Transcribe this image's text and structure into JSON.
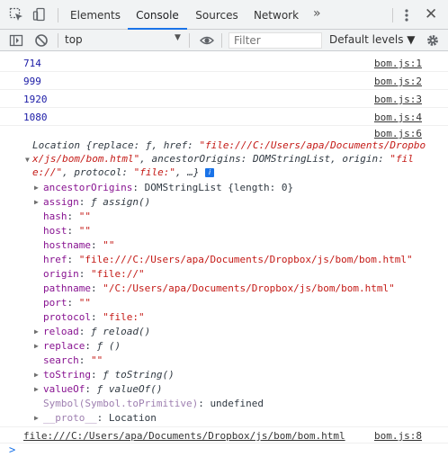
{
  "tabs": {
    "elements": "Elements",
    "console": "Console",
    "sources": "Sources",
    "network": "Network",
    "more": "»"
  },
  "toolbar": {
    "context": "top",
    "filter_placeholder": "Filter",
    "levels": "Default levels ▼"
  },
  "logs": {
    "l1": {
      "value": "714",
      "source": "bom.js:1"
    },
    "l2": {
      "value": "999",
      "source": "bom.js:2"
    },
    "l3": {
      "value": "1920",
      "source": "bom.js:3"
    },
    "l4": {
      "value": "1080",
      "source": "bom.js:4"
    },
    "l6": {
      "source": "bom.js:6",
      "summary1": "Location {replace: ƒ, href: ",
      "summary1_str": "\"file:///C:/Users/apa/Documents/Dropbo",
      "summary2_str": "x/js/bom/bom.html\"",
      "summary2": ", ancestorOrigins: DOMStringList, origin: ",
      "summary2_str2": "\"fil",
      "summary3_str": "e://\"",
      "summary3": ", protocol: ",
      "summary3_str2": "\"file:\"",
      "summary3_end": ", …}",
      "info": "i"
    },
    "l8": {
      "value": "file:///C:/Users/apa/Documents/Dropbox/js/bom/bom.html",
      "source": "bom.js:8"
    }
  },
  "props": {
    "ancestorOrigins": {
      "key": "ancestorOrigins",
      "val": "DOMStringList {length: 0}"
    },
    "assign": {
      "key": "assign",
      "val": "ƒ assign()"
    },
    "hash": {
      "key": "hash",
      "val": "\"\""
    },
    "host": {
      "key": "host",
      "val": "\"\""
    },
    "hostname": {
      "key": "hostname",
      "val": "\"\""
    },
    "href": {
      "key": "href",
      "val": "\"file:///C:/Users/apa/Documents/Dropbox/js/bom/bom.html\""
    },
    "origin": {
      "key": "origin",
      "val": "\"file://\""
    },
    "pathname": {
      "key": "pathname",
      "val": "\"/C:/Users/apa/Documents/Dropbox/js/bom/bom.html\""
    },
    "port": {
      "key": "port",
      "val": "\"\""
    },
    "protocol": {
      "key": "protocol",
      "val": "\"file:\""
    },
    "reload": {
      "key": "reload",
      "val": "ƒ reload()"
    },
    "replace": {
      "key": "replace",
      "val": "ƒ ()"
    },
    "search": {
      "key": "search",
      "val": "\"\""
    },
    "toString": {
      "key": "toString",
      "val": "ƒ toString()"
    },
    "valueOf": {
      "key": "valueOf",
      "val": "ƒ valueOf()"
    },
    "symbol": {
      "key": "Symbol(Symbol.toPrimitive)",
      "val": "undefined"
    },
    "proto": {
      "key": "__proto__",
      "val": "Location"
    }
  },
  "sep": ": ",
  "prompt": ">",
  "colors": {
    "accent": "#1a73e8",
    "number": "#1a1aa6",
    "string": "#c41a16",
    "key": "#881391"
  }
}
